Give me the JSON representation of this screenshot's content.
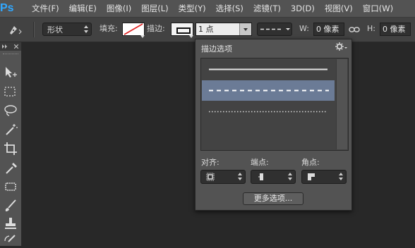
{
  "app": {
    "logo": "Ps"
  },
  "menu": [
    {
      "label": "文件(F)"
    },
    {
      "label": "编辑(E)"
    },
    {
      "label": "图像(I)"
    },
    {
      "label": "图层(L)"
    },
    {
      "label": "类型(Y)"
    },
    {
      "label": "选择(S)"
    },
    {
      "label": "滤镜(T)"
    },
    {
      "label": "3D(D)"
    },
    {
      "label": "视图(V)"
    },
    {
      "label": "窗口(W)"
    }
  ],
  "options": {
    "mode_value": "形状",
    "fill_label": "填充:",
    "stroke_label": "描边:",
    "stroke_width_value": "1 点",
    "w_label": "W:",
    "w_value": "0 像素",
    "h_label": "H:",
    "h_value": "0 像素",
    "icons": {
      "tool": "pen-icon",
      "fill": "no-color-swatch",
      "stroke": "stroke-swatch",
      "link": "link-icon"
    }
  },
  "stroke_panel": {
    "title": "描边选项",
    "line_styles": [
      {
        "style": "solid",
        "selected": false
      },
      {
        "style": "dashed",
        "selected": true
      },
      {
        "style": "dotted",
        "selected": false
      }
    ],
    "align_label": "对齐:",
    "caps_label": "端点:",
    "corners_label": "角点:",
    "more_button": "更多选项..."
  },
  "colors": {
    "accent": "#31a8ff",
    "selected_row": "#6b7b96"
  }
}
